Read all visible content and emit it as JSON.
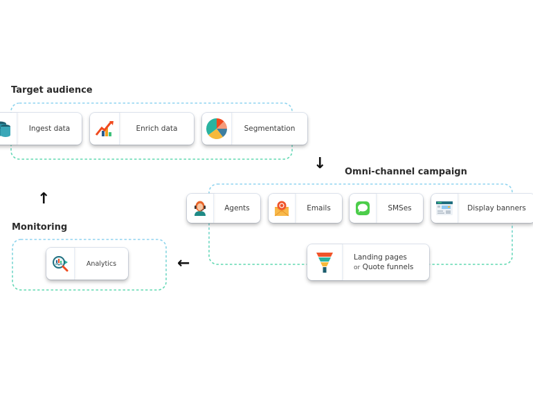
{
  "sections": {
    "target_audience": {
      "title": "Target audience",
      "cards": [
        {
          "label": "Ingest data",
          "icon": "database-icon"
        },
        {
          "label": "Enrich data",
          "icon": "growth-chart-icon"
        },
        {
          "label": "Segmentation",
          "icon": "pie-chart-icon"
        }
      ]
    },
    "omni_channel": {
      "title": "Omni-channel campaign",
      "cards": [
        {
          "label": "Agents",
          "icon": "agent-headset-icon"
        },
        {
          "label": "Emails",
          "icon": "email-envelope-icon"
        },
        {
          "label": "SMSes",
          "icon": "chat-bubble-icon"
        },
        {
          "label": "Display banners",
          "icon": "banner-browser-icon"
        }
      ],
      "funnel_card": {
        "line1": "Landing pages",
        "line2_prefix": "or",
        "line2": "Quote funnels",
        "icon": "funnel-icon"
      }
    },
    "monitoring": {
      "title": "Monitoring",
      "cards": [
        {
          "label": "Analytics",
          "icon": "analytics-magnifier-icon"
        }
      ]
    }
  },
  "arrows": {
    "down": "↓",
    "up": "↑",
    "left": "←"
  },
  "colors": {
    "dash_top": "#8fd3f0",
    "dash_bottom": "#5fd8b0"
  }
}
